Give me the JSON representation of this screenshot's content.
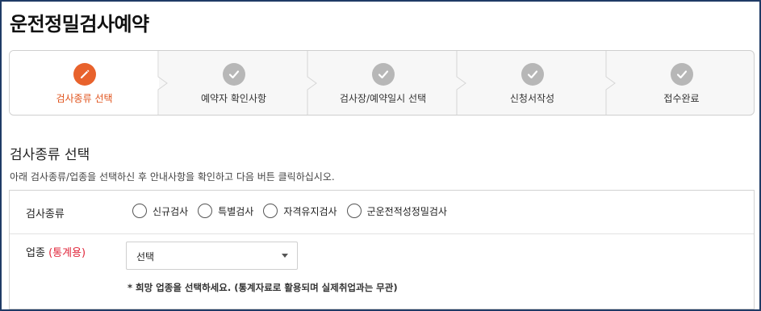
{
  "page": {
    "title": "운전정밀검사예약"
  },
  "steps": [
    {
      "label": "검사종류 선택",
      "icon": "pencil-icon",
      "state": "active"
    },
    {
      "label": "예약자 확인사항",
      "icon": "check-icon",
      "state": "pending"
    },
    {
      "label": "검사장/예약일시 선택",
      "icon": "check-icon",
      "state": "pending"
    },
    {
      "label": "신청서작성",
      "icon": "check-icon",
      "state": "pending"
    },
    {
      "label": "접수완료",
      "icon": "check-icon",
      "state": "pending"
    }
  ],
  "section": {
    "title": "검사종류 선택",
    "description": "아래 검사종류/업종을 선택하신 후 안내사항을 확인하고 다음 버튼 클릭하십시오."
  },
  "form": {
    "inspection_type": {
      "label": "검사종류",
      "options": [
        "신규검사",
        "특별검사",
        "자격유지검사",
        "군운전적성정밀검사"
      ]
    },
    "industry": {
      "label": "업종",
      "label_note": "(통계용)",
      "selected": "선택",
      "hint": "* 희망 업종을 선택하세요. (통계자료로 활용되며 실제취업과는 무관)"
    }
  },
  "colors": {
    "accent": "#e8622c",
    "inactive_step": "#b7b7b7",
    "note_red": "#e0263a",
    "frame_border": "#1f3b66"
  }
}
